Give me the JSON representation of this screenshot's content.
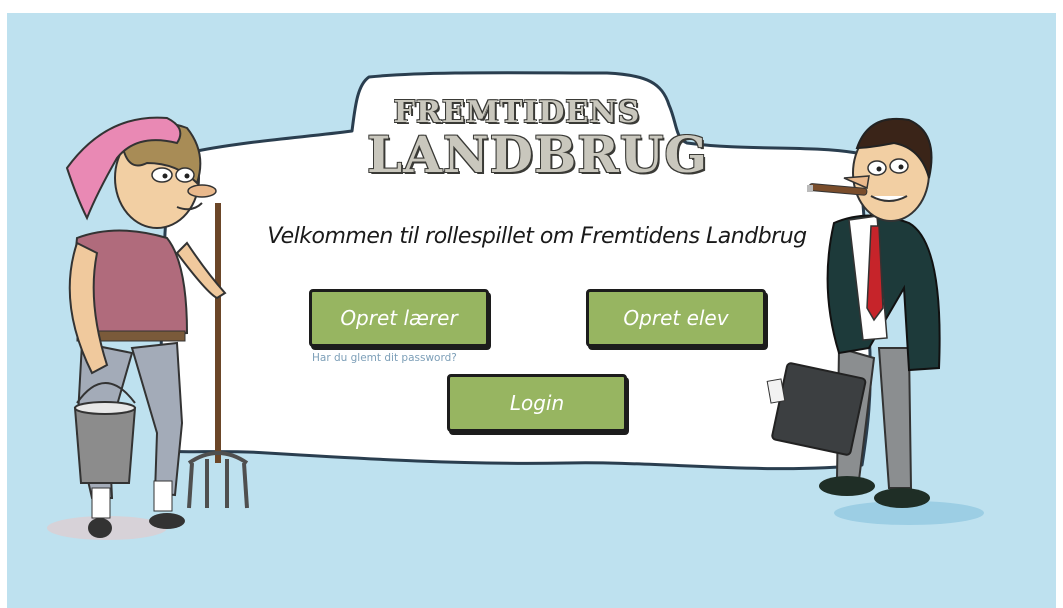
{
  "logo": {
    "line1": "FREMTIDENS",
    "line2": "LANDBRUG"
  },
  "welcome_text": "Velkommen til rollespillet om Fremtidens Landbrug",
  "buttons": {
    "create_teacher": "Opret lærer",
    "create_student": "Opret elev",
    "login": "Login"
  },
  "forgot_password": "Har du glemt dit password?",
  "colors": {
    "background": "#bee1ef",
    "button": "#97b561",
    "cloud": "#ffffff"
  }
}
